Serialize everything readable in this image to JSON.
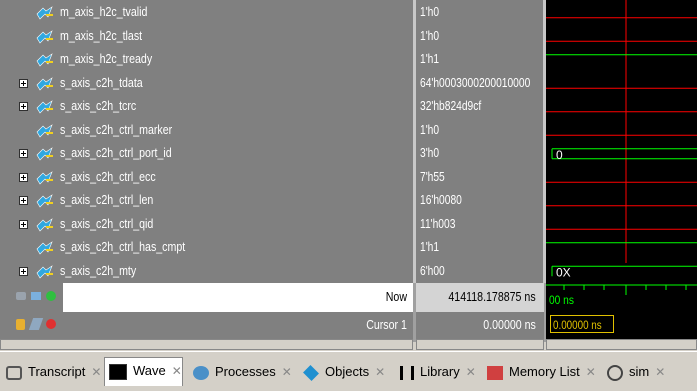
{
  "signals": [
    {
      "name": "m_axis_h2c_tvalid",
      "value": "1'h0",
      "expandable": false
    },
    {
      "name": "m_axis_h2c_tlast",
      "value": "1'h0",
      "expandable": false
    },
    {
      "name": "m_axis_h2c_tready",
      "value": "1'h1",
      "expandable": false
    },
    {
      "name": "s_axis_c2h_tdata",
      "value": "64'h0003000200010000",
      "expandable": true
    },
    {
      "name": "s_axis_c2h_tcrc",
      "value": "32'hb824d9cf",
      "expandable": true
    },
    {
      "name": "s_axis_c2h_ctrl_marker",
      "value": "1'h0",
      "expandable": false
    },
    {
      "name": "s_axis_c2h_ctrl_port_id",
      "value": "3'h0",
      "expandable": true
    },
    {
      "name": "s_axis_c2h_ctrl_ecc",
      "value": "7'h55",
      "expandable": true
    },
    {
      "name": "s_axis_c2h_ctrl_len",
      "value": "16'h0080",
      "expandable": true
    },
    {
      "name": "s_axis_c2h_ctrl_qid",
      "value": "11'h003",
      "expandable": true
    },
    {
      "name": "s_axis_c2h_ctrl_has_cmpt",
      "value": "1'h1",
      "expandable": false
    },
    {
      "name": "s_axis_c2h_mty",
      "value": "6'h00",
      "expandable": true
    }
  ],
  "wave_labels": {
    "port_id": "0",
    "mty": "0X"
  },
  "status": {
    "now_label": "Now",
    "now_value": "414118.178875 ns",
    "now_wave": "00 ns",
    "cursor_label": "Cursor 1",
    "cursor_value": "0.00000 ns",
    "cursor_wave": "0.00000 ns"
  },
  "tabs": [
    {
      "label": "Transcript",
      "icon": "transcript-icon"
    },
    {
      "label": "Wave",
      "icon": "wave-icon"
    },
    {
      "label": "Processes",
      "icon": "processes-icon"
    },
    {
      "label": "Objects",
      "icon": "objects-icon"
    },
    {
      "label": "Library",
      "icon": "library-icon"
    },
    {
      "label": "Memory List",
      "icon": "memory-list-icon"
    },
    {
      "label": "sim",
      "icon": "sim-icon"
    }
  ],
  "colors": {
    "wave_low": "#ff0000",
    "wave_high": "#00ff00",
    "bus": "#00ff00",
    "cursor_box": "#e0c000"
  }
}
